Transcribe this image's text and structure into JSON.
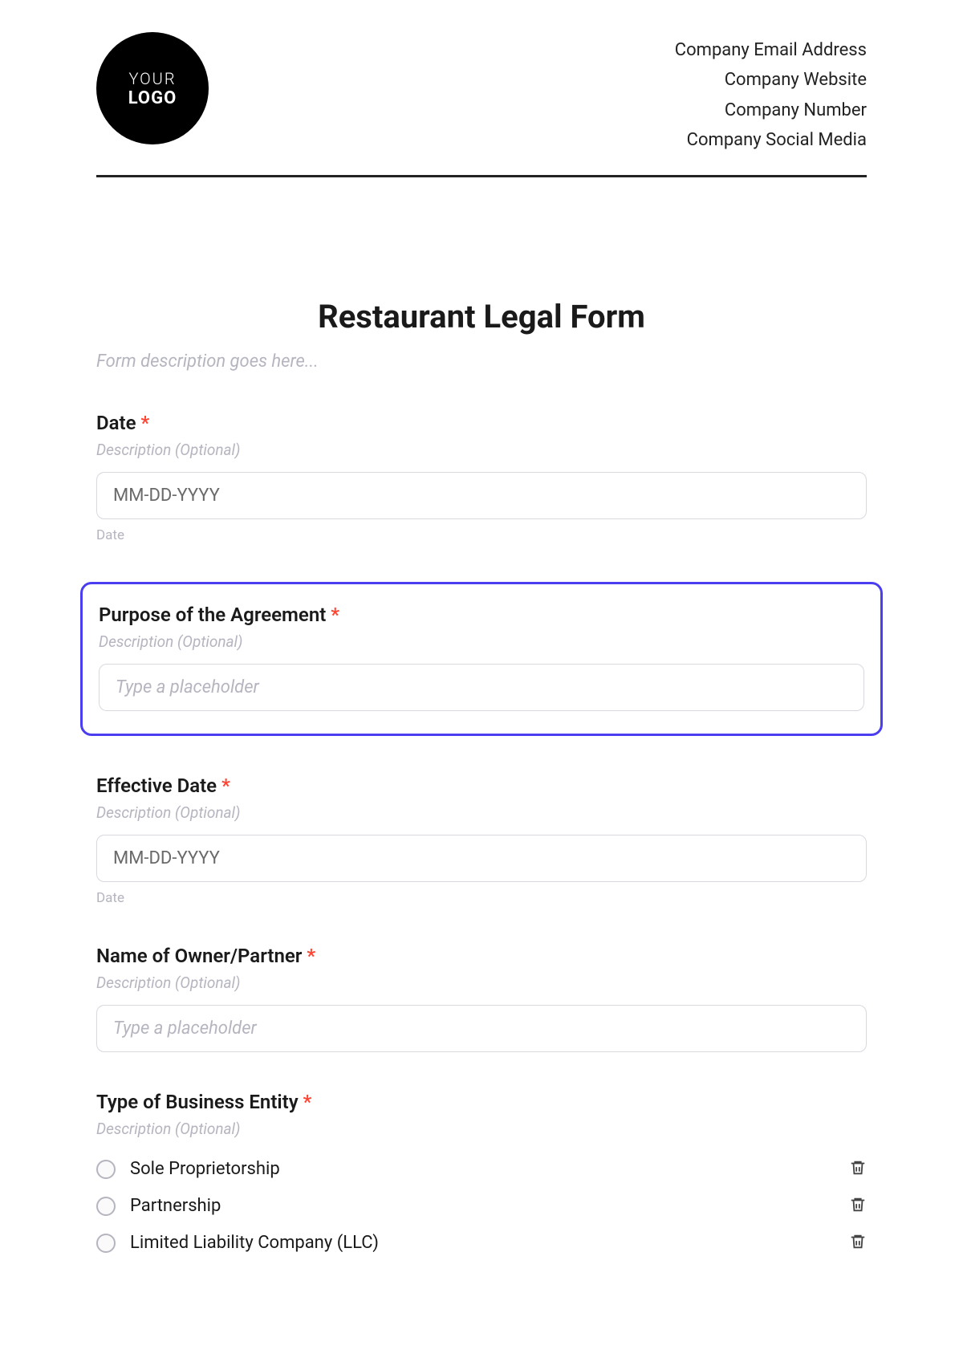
{
  "header": {
    "logo": {
      "line1": "YOUR",
      "line2": "LOGO"
    },
    "company_info": [
      "Company Email Address",
      "Company Website",
      "Company Number",
      "Company Social Media"
    ]
  },
  "form": {
    "title": "Restaurant Legal Form",
    "description_placeholder": "Form description goes here..."
  },
  "fields": {
    "date": {
      "label": "Date",
      "required": "*",
      "sub": "Description (Optional)",
      "placeholder": "MM-DD-YYYY",
      "caption": "Date"
    },
    "purpose": {
      "label": "Purpose of the Agreement",
      "required": "*",
      "sub": "Description (Optional)",
      "placeholder": "Type a placeholder"
    },
    "effective_date": {
      "label": "Effective Date",
      "required": "*",
      "sub": "Description (Optional)",
      "placeholder": "MM-DD-YYYY",
      "caption": "Date"
    },
    "owner": {
      "label": "Name of Owner/Partner",
      "required": "*",
      "sub": "Description (Optional)",
      "placeholder": "Type a placeholder"
    },
    "entity": {
      "label": "Type of Business Entity",
      "required": "*",
      "sub": "Description (Optional)",
      "options": [
        "Sole Proprietorship",
        "Partnership",
        "Limited Liability Company (LLC)"
      ]
    }
  }
}
